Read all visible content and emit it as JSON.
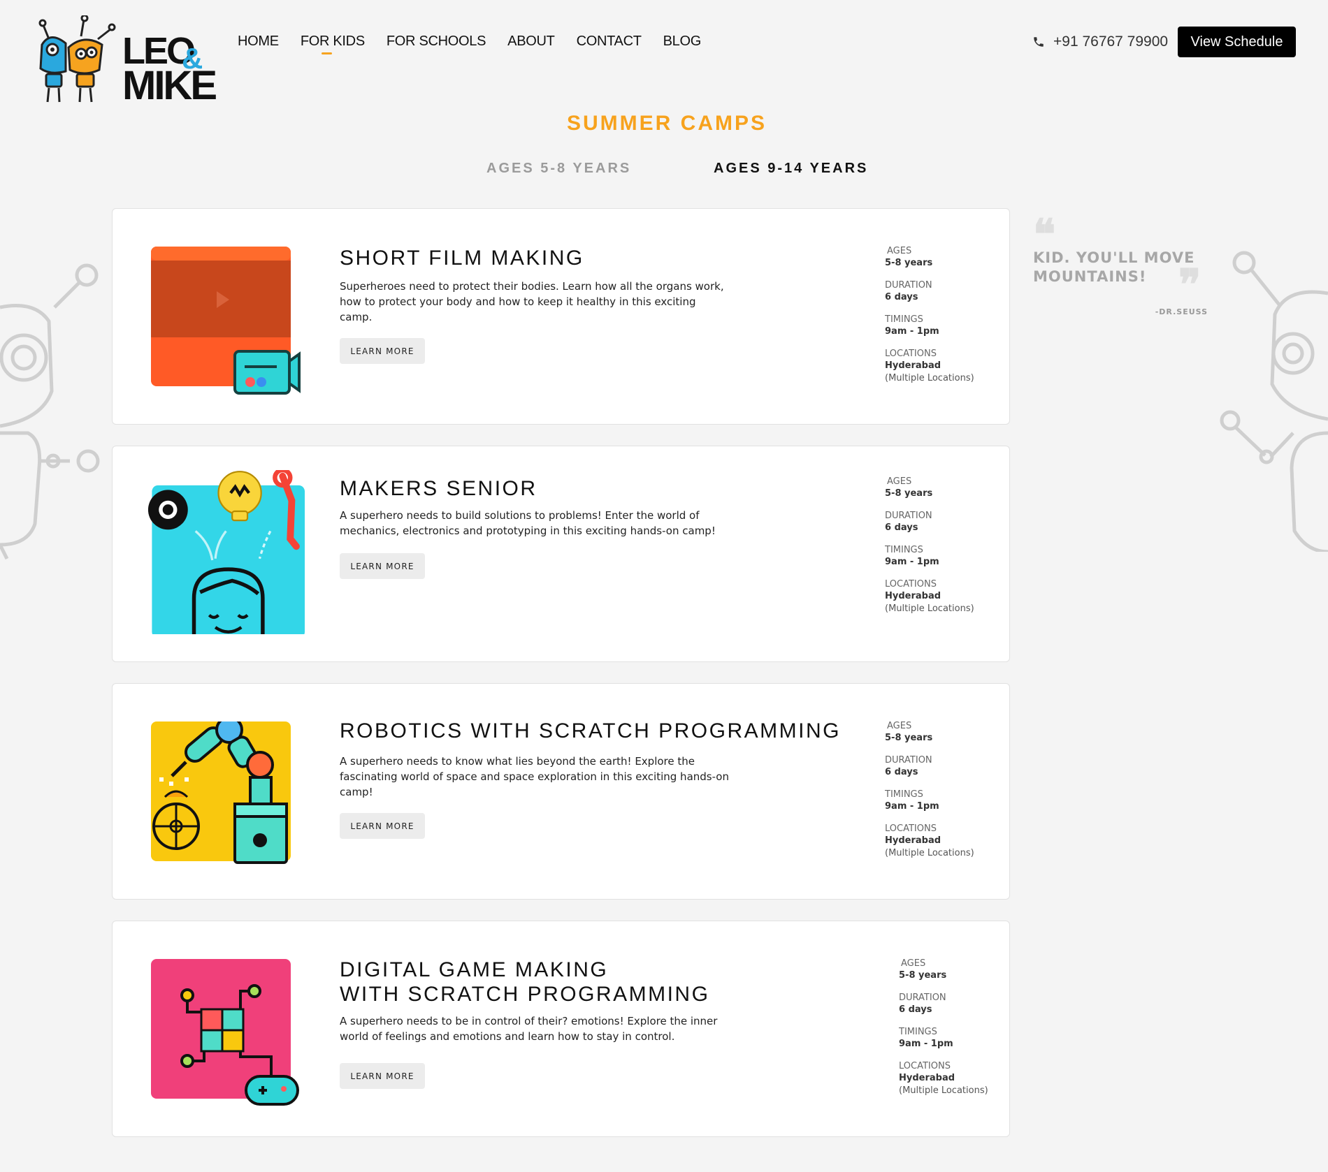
{
  "brand": {
    "line1": "LEO",
    "amp": "&",
    "line2": "MIKE"
  },
  "nav": [
    "HOME",
    "FOR KIDS",
    "FOR SCHOOLS",
    "ABOUT",
    "CONTACT",
    "BLOG"
  ],
  "nav_active": "FOR KIDS",
  "phone": "+91 76767 79900",
  "schedule_button": "View Schedule",
  "page_title": "SUMMER CAMPS",
  "tabs": [
    "AGES 5-8 YEARS",
    "AGES 9-14 YEARS"
  ],
  "active_tab": "AGES 9-14 YEARS",
  "quote": {
    "text": "KID. YOU'LL MOVE MOUNTAINS!",
    "author": "-DR.SEUSS"
  },
  "meta_labels": {
    "ages": "AGES",
    "duration": "DURATION",
    "timings": "TIMINGS",
    "locations": "LOCATIONS"
  },
  "cards": [
    {
      "title": "SHORT FILM MAKING",
      "desc": "Superheroes need to protect their bodies. Learn how all the organs work, how to protect your body and how to keep it healthy in this exciting camp.",
      "button": "LEARN MORE",
      "ages": "5-8 years",
      "duration": "6 days",
      "timings": "9am - 1pm",
      "location": "Hyderabad",
      "location_note": "(Multiple Locations)",
      "icon": "film-camera-icon"
    },
    {
      "title": "MAKERS SENIOR",
      "desc": "A superhero needs to build solutions to problems! Enter the world of mechanics, electronics and prototyping in this exciting hands-on camp!",
      "button": "LEARN MORE",
      "ages": "5-8 years",
      "duration": "6 days",
      "timings": "9am - 1pm",
      "location": "Hyderabad",
      "location_note": "(Multiple Locations)",
      "icon": "maker-kid-icon"
    },
    {
      "title": "ROBOTICS WITH SCRATCH PROGRAMMING",
      "desc": "A superhero needs to know what lies beyond the earth! Explore the fascinating world of space and space exploration in this exciting hands-on camp!",
      "button": "LEARN MORE",
      "ages": "5-8 years",
      "duration": "6 days",
      "timings": "9am - 1pm",
      "location": "Hyderabad",
      "location_note": "(Multiple Locations)",
      "icon": "robot-arm-icon"
    },
    {
      "title": "DIGITAL GAME MAKING",
      "title2": "WITH SCRATCH PROGRAMMING",
      "desc": "A superhero needs to be in control of their? emotions! Explore the inner world of feelings and emotions and learn how to stay in control.",
      "button": "LEARN MORE",
      "ages": "5-8 years",
      "duration": "6 days",
      "timings": "9am - 1pm",
      "location": "Hyderabad",
      "location_note": "(Multiple Locations)",
      "icon": "puzzle-gamepad-icon"
    }
  ],
  "colors": {
    "accent": "#f7a21d",
    "logo_amp": "#2aa8de",
    "button_dark": "#000000"
  }
}
